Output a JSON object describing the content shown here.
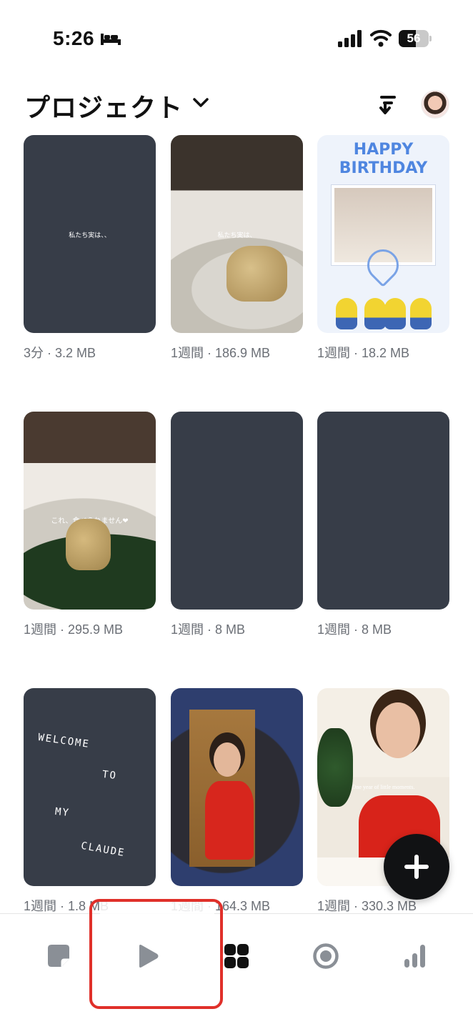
{
  "status_bar": {
    "time": "5:26",
    "battery": "56",
    "battery_level": 0.56,
    "icons": [
      "bed-icon",
      "signal-icon",
      "wifi-icon",
      "battery-icon"
    ]
  },
  "header": {
    "title": "プロジェクト",
    "icons": [
      "chevron-down-icon",
      "sort-icon",
      "avatar"
    ]
  },
  "projects": [
    {
      "meta": "3分 · 3.2 MB",
      "overlay": "私たち実は、、",
      "type": "blank-text"
    },
    {
      "meta": "1週間 · 186.9 MB",
      "overlay": "私たち実は、",
      "type": "photo"
    },
    {
      "meta": "1週間 · 18.2 MB",
      "overlay": "HAPPY BIRTHDAY",
      "type": "graphic"
    },
    {
      "meta": "1週間 · 295.9 MB",
      "overlay": "これ、食べられません❤",
      "type": "photo"
    },
    {
      "meta": "1週間 · 8 MB",
      "overlay": "",
      "type": "blank"
    },
    {
      "meta": "1週間 · 8 MB",
      "overlay": "",
      "type": "blank"
    },
    {
      "meta": "1週間 · 1.8 MB",
      "overlay_lines": [
        "WELCOME",
        "TO",
        "MY",
        "CLAUDE"
      ],
      "type": "text"
    },
    {
      "meta": "1週間 · 164.3 MB",
      "overlay": "",
      "type": "photo"
    },
    {
      "meta": "1週間 · 330.3 MB",
      "overlay": "One year of little moments.",
      "type": "photo"
    }
  ],
  "fab": {
    "icon": "plus-icon"
  },
  "bottom_nav": {
    "items": [
      {
        "icon": "notes-icon"
      },
      {
        "icon": "play-icon",
        "highlighted": true
      },
      {
        "icon": "grid-icon",
        "active": true
      },
      {
        "icon": "record-icon"
      },
      {
        "icon": "stats-icon"
      }
    ]
  },
  "colors": {
    "tile_dark": "#373d48",
    "highlight": "#e0302a",
    "nav_inactive": "#8a8f96",
    "nav_active": "#111111"
  }
}
